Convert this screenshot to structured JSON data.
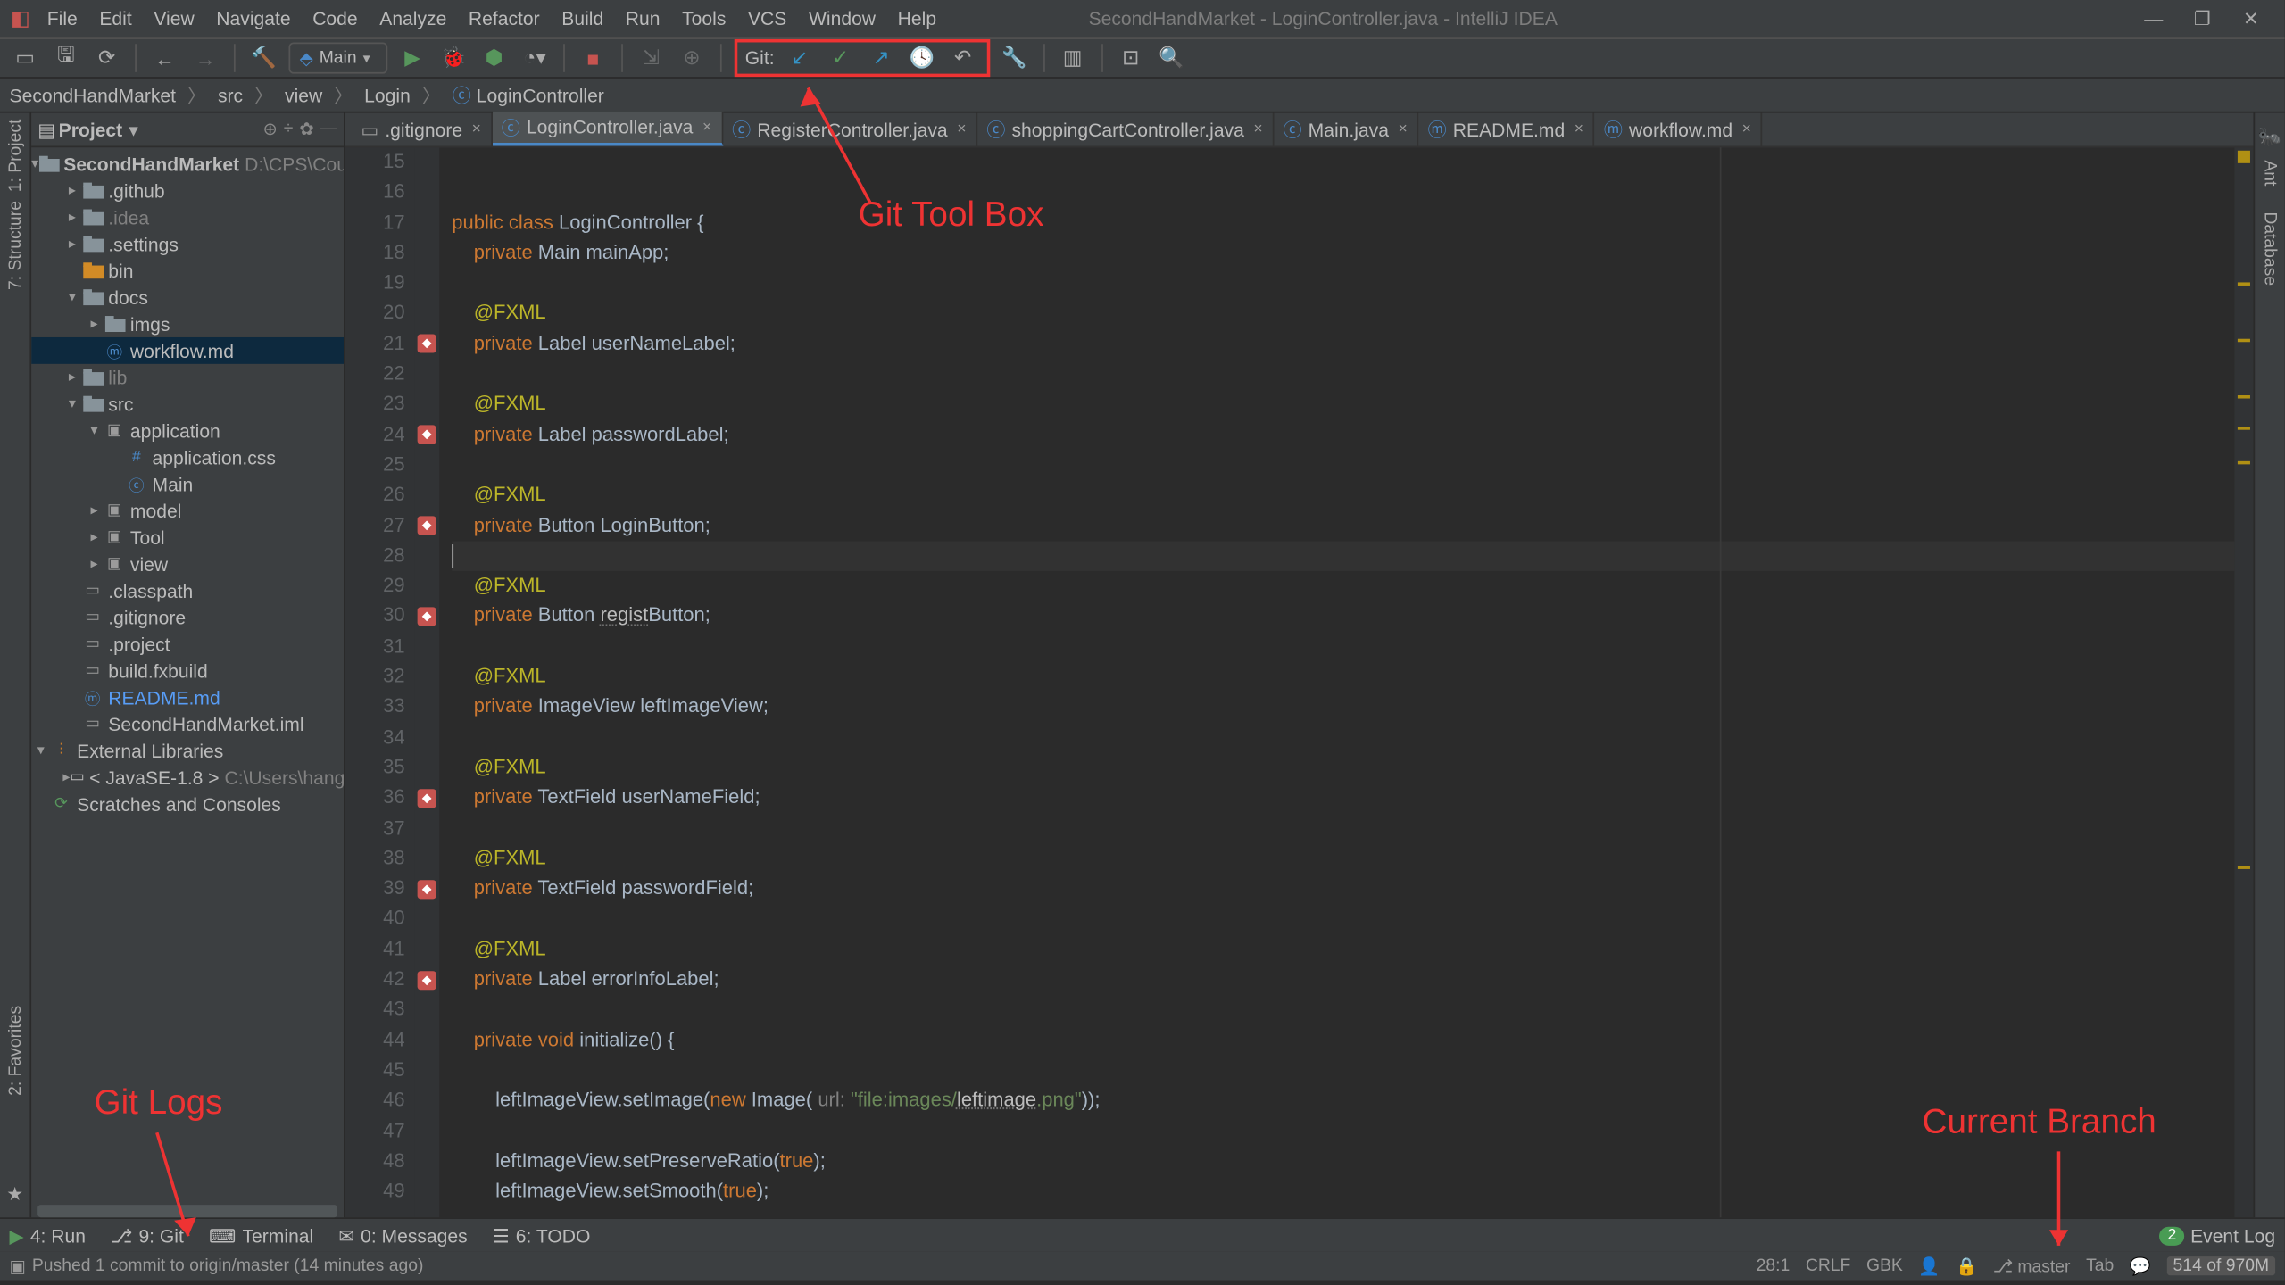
{
  "window": {
    "title": "SecondHandMarket - LoginController.java - IntelliJ IDEA",
    "min": "—",
    "max": "❐",
    "close": "✕"
  },
  "menus": [
    "File",
    "Edit",
    "View",
    "Navigate",
    "Code",
    "Analyze",
    "Refactor",
    "Build",
    "Run",
    "Tools",
    "VCS",
    "Window",
    "Help"
  ],
  "runConfig": "Main",
  "gitLabel": "Git:",
  "breadcrumbs": [
    "SecondHandMarket",
    "src",
    "view",
    "Login",
    "LoginController"
  ],
  "projectPanel": {
    "header": "Project",
    "rootName": "SecondHandMarket",
    "rootPath": "D:\\CPS\\Cou",
    "items": [
      {
        "indent": 1,
        "exp": "▸",
        "kind": "folder",
        "name": ".github"
      },
      {
        "indent": 1,
        "exp": "▸",
        "kind": "folder",
        "name": ".idea",
        "dim": true
      },
      {
        "indent": 1,
        "exp": "▸",
        "kind": "folder",
        "name": ".settings"
      },
      {
        "indent": 1,
        "exp": "",
        "kind": "folder",
        "name": "bin",
        "orange": true
      },
      {
        "indent": 1,
        "exp": "▾",
        "kind": "folder",
        "name": "docs"
      },
      {
        "indent": 2,
        "exp": "▸",
        "kind": "folder",
        "name": "imgs"
      },
      {
        "indent": 2,
        "exp": "",
        "kind": "md",
        "name": "workflow.md",
        "sel": true
      },
      {
        "indent": 1,
        "exp": "▸",
        "kind": "folder",
        "name": "lib",
        "dim": true
      },
      {
        "indent": 1,
        "exp": "▾",
        "kind": "folder",
        "name": "src"
      },
      {
        "indent": 2,
        "exp": "▾",
        "kind": "pkg",
        "name": "application"
      },
      {
        "indent": 3,
        "exp": "",
        "kind": "css",
        "name": "application.css"
      },
      {
        "indent": 3,
        "exp": "",
        "kind": "class",
        "name": "Main"
      },
      {
        "indent": 2,
        "exp": "▸",
        "kind": "pkg",
        "name": "model"
      },
      {
        "indent": 2,
        "exp": "▸",
        "kind": "pkg",
        "name": "Tool"
      },
      {
        "indent": 2,
        "exp": "▸",
        "kind": "pkg",
        "name": "view"
      },
      {
        "indent": 1,
        "exp": "",
        "kind": "file",
        "name": ".classpath"
      },
      {
        "indent": 1,
        "exp": "",
        "kind": "file",
        "name": ".gitignore"
      },
      {
        "indent": 1,
        "exp": "",
        "kind": "file",
        "name": ".project"
      },
      {
        "indent": 1,
        "exp": "",
        "kind": "file",
        "name": "build.fxbuild"
      },
      {
        "indent": 1,
        "exp": "",
        "kind": "md",
        "name": "README.md",
        "blue": true
      },
      {
        "indent": 1,
        "exp": "",
        "kind": "file",
        "name": "SecondHandMarket.iml"
      }
    ],
    "extLib": "External Libraries",
    "jdk": "< JavaSE-1.8 >",
    "jdkPath": "C:\\Users\\hangz",
    "scratches": "Scratches and Consoles"
  },
  "tabs": [
    {
      "name": ".gitignore",
      "kind": "file"
    },
    {
      "name": "LoginController.java",
      "kind": "class",
      "active": true
    },
    {
      "name": "RegisterController.java",
      "kind": "class"
    },
    {
      "name": "shoppingCartController.java",
      "kind": "class"
    },
    {
      "name": "Main.java",
      "kind": "class"
    },
    {
      "name": "README.md",
      "kind": "md"
    },
    {
      "name": "workflow.md",
      "kind": "md"
    }
  ],
  "code": {
    "start": 15,
    "lines": [
      {
        "n": 15,
        "t": ""
      },
      {
        "n": 16,
        "t": ""
      },
      {
        "n": 17,
        "t": "public class LoginController {",
        "seg": [
          [
            "kw",
            "public class "
          ],
          [
            "ident",
            "LoginController {"
          ]
        ]
      },
      {
        "n": 18,
        "t": "    private Main mainApp;",
        "seg": [
          [
            "kw",
            "    private "
          ],
          [
            "ident",
            "Main mainApp;"
          ]
        ]
      },
      {
        "n": 19,
        "t": ""
      },
      {
        "n": 20,
        "t": "    @FXML",
        "seg": [
          [
            "anno",
            "    @FXML"
          ]
        ]
      },
      {
        "n": 21,
        "t": "    private Label userNameLabel;",
        "mark": true,
        "seg": [
          [
            "kw",
            "    private "
          ],
          [
            "ident",
            "Label userNameLabel;"
          ]
        ]
      },
      {
        "n": 22,
        "t": ""
      },
      {
        "n": 23,
        "t": "    @FXML",
        "seg": [
          [
            "anno",
            "    @FXML"
          ]
        ]
      },
      {
        "n": 24,
        "t": "    private Label passwordLabel;",
        "mark": true,
        "seg": [
          [
            "kw",
            "    private "
          ],
          [
            "ident",
            "Label passwordLabel;"
          ]
        ]
      },
      {
        "n": 25,
        "t": ""
      },
      {
        "n": 26,
        "t": "    @FXML",
        "seg": [
          [
            "anno",
            "    @FXML"
          ]
        ]
      },
      {
        "n": 27,
        "t": "    private Button LoginButton;",
        "mark": true,
        "seg": [
          [
            "kw",
            "    private "
          ],
          [
            "ident",
            "Button LoginButton;"
          ]
        ]
      },
      {
        "n": 28,
        "t": "",
        "cursor": true
      },
      {
        "n": 29,
        "t": "    @FXML",
        "seg": [
          [
            "anno",
            "    @FXML"
          ]
        ]
      },
      {
        "n": 30,
        "t": "    private Button registButton;",
        "mark": true,
        "seg": [
          [
            "kw",
            "    private "
          ],
          [
            "ident",
            "Button "
          ],
          [
            "underl",
            "regist"
          ],
          [
            "ident",
            "Button;"
          ]
        ]
      },
      {
        "n": 31,
        "t": ""
      },
      {
        "n": 32,
        "t": "    @FXML",
        "seg": [
          [
            "anno",
            "    @FXML"
          ]
        ]
      },
      {
        "n": 33,
        "t": "    private ImageView leftImageView;",
        "seg": [
          [
            "kw",
            "    private "
          ],
          [
            "ident",
            "ImageView leftImageView;"
          ]
        ]
      },
      {
        "n": 34,
        "t": ""
      },
      {
        "n": 35,
        "t": "    @FXML",
        "seg": [
          [
            "anno",
            "    @FXML"
          ]
        ]
      },
      {
        "n": 36,
        "t": "    private TextField userNameField;",
        "mark": true,
        "seg": [
          [
            "kw",
            "    private "
          ],
          [
            "ident",
            "TextField userNameField;"
          ]
        ]
      },
      {
        "n": 37,
        "t": ""
      },
      {
        "n": 38,
        "t": "    @FXML",
        "seg": [
          [
            "anno",
            "    @FXML"
          ]
        ]
      },
      {
        "n": 39,
        "t": "    private TextField passwordField;",
        "mark": true,
        "seg": [
          [
            "kw",
            "    private "
          ],
          [
            "ident",
            "TextField passwordField;"
          ]
        ]
      },
      {
        "n": 40,
        "t": ""
      },
      {
        "n": 41,
        "t": "    @FXML",
        "seg": [
          [
            "anno",
            "    @FXML"
          ]
        ]
      },
      {
        "n": 42,
        "t": "    private Label errorInfoLabel;",
        "mark": true,
        "seg": [
          [
            "kw",
            "    private "
          ],
          [
            "ident",
            "Label errorInfoLabel;"
          ]
        ]
      },
      {
        "n": 43,
        "t": ""
      },
      {
        "n": 44,
        "t": "    private void initialize() {",
        "seg": [
          [
            "kw",
            "    private void "
          ],
          [
            "ident",
            "initialize() {"
          ]
        ]
      },
      {
        "n": 45,
        "t": ""
      },
      {
        "n": 46,
        "t": "        leftImageView.setImage(new Image( url: \"file:images/leftimage.png\"));",
        "seg": [
          [
            "ident",
            "        leftImageView.setImage("
          ],
          [
            "kw",
            "new "
          ],
          [
            "ident",
            "Image( "
          ],
          [
            "param",
            "url: "
          ],
          [
            "str",
            "\"file:images/"
          ],
          [
            "underl",
            "leftimage"
          ],
          [
            "str",
            ".png\""
          ],
          [
            "ident",
            "));"
          ]
        ]
      },
      {
        "n": 47,
        "t": ""
      },
      {
        "n": 48,
        "t": "        leftImageView.setPreserveRatio(true);",
        "seg": [
          [
            "ident",
            "        leftImageView.setPreserveRatio("
          ],
          [
            "kw",
            "true"
          ],
          [
            "ident",
            ");"
          ]
        ]
      },
      {
        "n": 49,
        "t": "        leftImageView.setSmooth(true);",
        "seg": [
          [
            "ident",
            "        leftImageView.setSmooth("
          ],
          [
            "kw",
            "true"
          ],
          [
            "ident",
            ");"
          ]
        ]
      }
    ]
  },
  "leftTabs": {
    "project": "1: Project",
    "structure": "7: Structure",
    "favorites": "2: Favorites"
  },
  "rightTabs": {
    "ant": "Ant",
    "database": "Database"
  },
  "bottom": {
    "run": "4: Run",
    "git": "9: Git",
    "terminal": "Terminal",
    "messages": "0: Messages",
    "todo": "6: TODO",
    "eventlog": "Event Log",
    "eventcount": "2"
  },
  "status": {
    "msg": "Pushed 1 commit to origin/master (14 minutes ago)",
    "pos": "28:1",
    "eol": "CRLF",
    "enc": "GBK",
    "branch": "master",
    "tab": "Tab",
    "mem": "514 of 970M"
  },
  "annotations": {
    "gitToolBox": "Git Tool Box",
    "gitLogs": "Git Logs",
    "currentBranch": "Current Branch"
  }
}
